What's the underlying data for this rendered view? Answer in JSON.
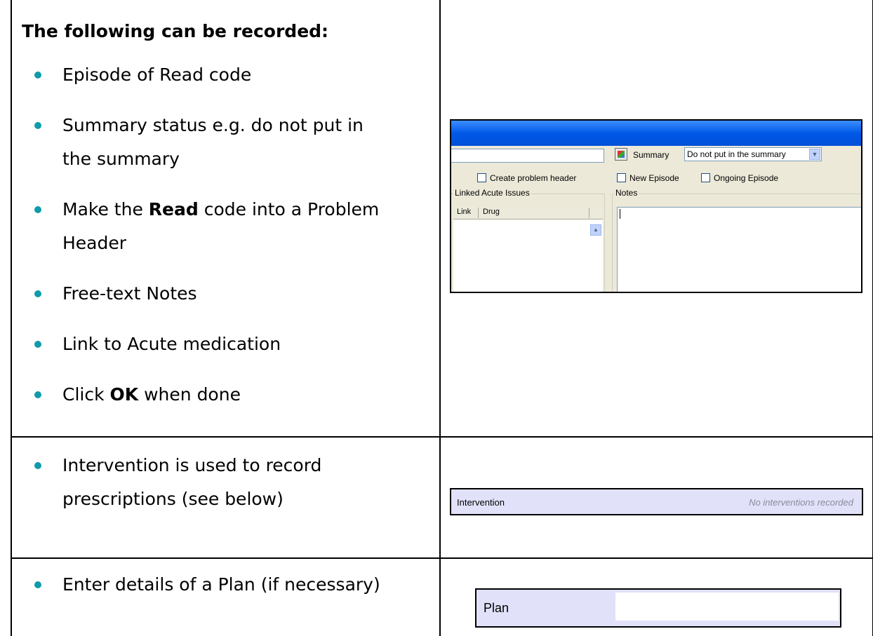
{
  "row1": {
    "heading": "The following can be recorded:",
    "bullets": [
      [
        "Episode of Read code"
      ],
      [
        "Summary status e.g. do not put in",
        "the summary"
      ],
      [
        "Make the ",
        "Read",
        " code into a Problem",
        "Header"
      ],
      [
        "Free-text Notes"
      ],
      [
        "Link to Acute medication"
      ],
      [
        "Click ",
        "OK",
        " when done"
      ]
    ]
  },
  "row2": {
    "bullet_line1": "Intervention is used to record",
    "bullet_line2": "prescriptions (see below)"
  },
  "row3": {
    "bullet": "Enter details of a Plan (if necessary)"
  },
  "shot1": {
    "summary_label": "Summary",
    "summary_select_value": "Do not put in the summary",
    "create_problem_header": "Create problem header",
    "new_episode": "New Episode",
    "ongoing_episode": "Ongoing Episode",
    "linked_acute_issues": "Linked Acute Issues",
    "notes_label": "Notes",
    "col_link": "Link",
    "col_drug": "Drug"
  },
  "shot2": {
    "label": "Intervention",
    "status": "No interventions recorded"
  },
  "shot3": {
    "label": "Plan"
  },
  "colors": {
    "bullet": "#0f9ba8",
    "panel_bg": "#e1e1fa",
    "xp_title": "#0058e6"
  }
}
